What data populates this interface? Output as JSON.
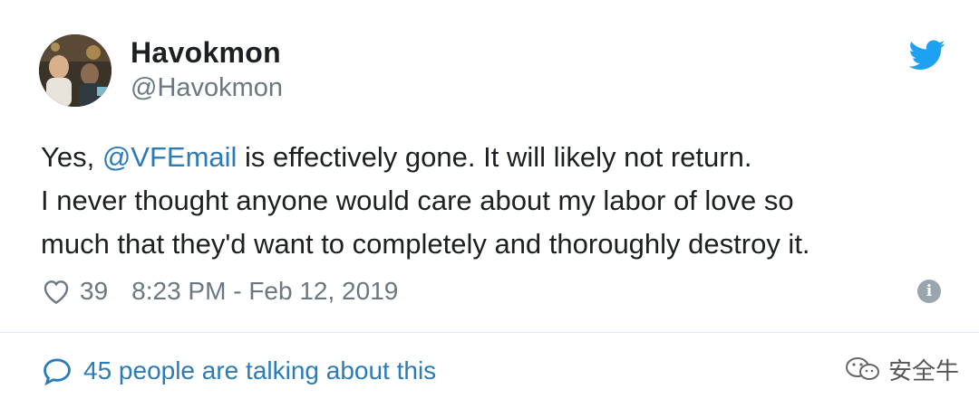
{
  "tweet": {
    "display_name": "Havokmon",
    "handle": "@Havokmon",
    "text": {
      "line1_before": "Yes, ",
      "mention": "@VFEmail",
      "line1_after": " is effectively gone. It will likely not return.",
      "line2": "I never thought anyone would care about my labor of love so",
      "line3": "much that they'd want to completely and thoroughly destroy it."
    },
    "like_count": "39",
    "timestamp": "8:23 PM - Feb 12, 2019",
    "talking": "45 people are talking about this"
  },
  "watermark": {
    "text": "安全牛"
  },
  "icons": {
    "bird": "twitter-bird-icon",
    "heart": "heart-icon",
    "info": "info-icon",
    "bubble": "speech-bubble-icon"
  },
  "colors": {
    "link": "#2b7bb9",
    "twitter_blue": "#1da1f2",
    "muted": "#697882",
    "text": "#1c2022"
  }
}
